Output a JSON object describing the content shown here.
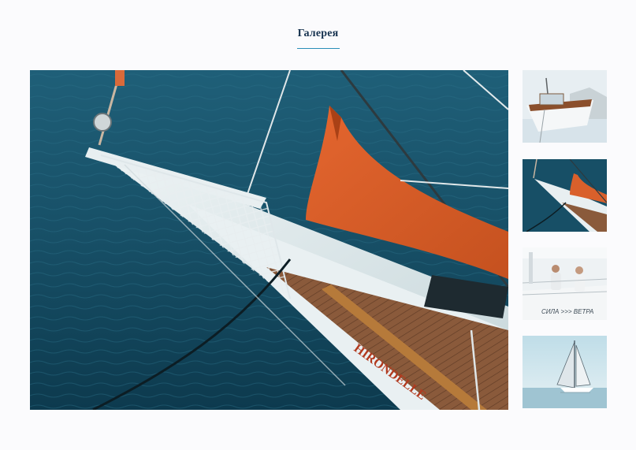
{
  "gallery": {
    "title": "Галерея",
    "accent_color": "#2a8fb8",
    "title_color": "#16324f"
  },
  "main_photo": {
    "hull_name": "HIRONDELLE"
  },
  "thumbnails": [
    {
      "subject": "wooden-motorboat"
    },
    {
      "subject": "sailboat-bow"
    },
    {
      "subject": "sailing-crew",
      "hull_text": "СИЛА >>> ВЕТРА"
    },
    {
      "subject": "sailboat-on-sea"
    }
  ]
}
